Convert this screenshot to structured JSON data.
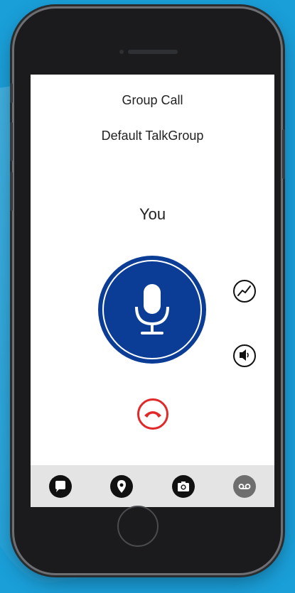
{
  "call": {
    "type_label": "Group Call",
    "talkgroup": "Default TalkGroup",
    "speaker": "You"
  },
  "icons": {
    "ptt": "microphone-icon",
    "presence": "activity-icon",
    "audio_route": "speaker-icon",
    "end_call": "hang-up-icon"
  },
  "tabs": [
    {
      "name": "messages",
      "icon": "chat-bubble-icon",
      "active": true
    },
    {
      "name": "location",
      "icon": "map-pin-icon",
      "active": true
    },
    {
      "name": "camera",
      "icon": "camera-icon",
      "active": true
    },
    {
      "name": "voicemail",
      "icon": "voicemail-icon",
      "active": false
    }
  ],
  "colors": {
    "background": "#1a9fd9",
    "ptt_button": "#0c3d96",
    "end_call": "#e22828"
  }
}
